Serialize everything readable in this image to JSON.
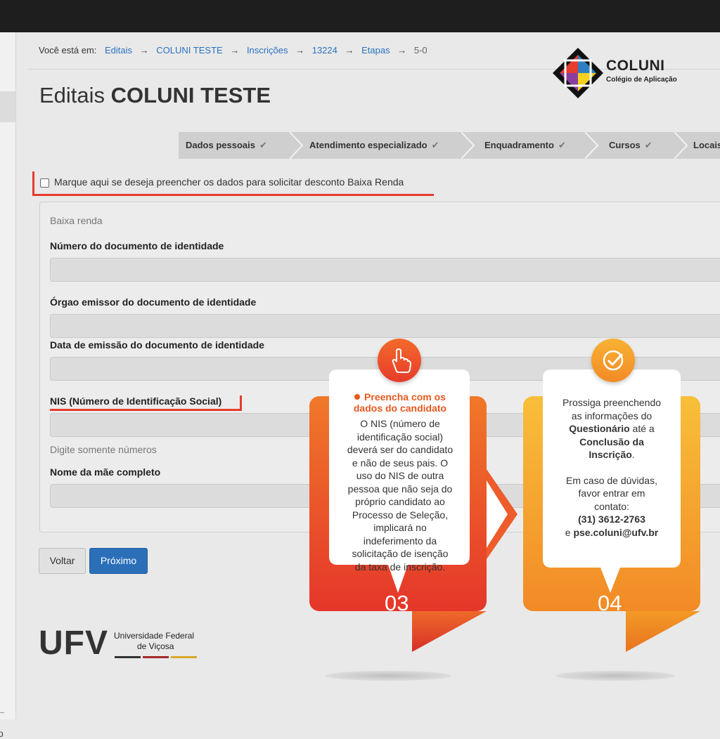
{
  "breadcrumb": {
    "label": "Você está em:",
    "links": [
      "Editais",
      "COLUNI TESTE",
      "Inscrições",
      "13224",
      "Etapas"
    ],
    "current": "5-0",
    "arrow": "→"
  },
  "logo": {
    "name": "COLUNI",
    "subtitle": "Colégio de Aplicação"
  },
  "page": {
    "title_prefix": "Editais",
    "title_bold": "COLUNI TESTE"
  },
  "steps": {
    "items": [
      "Dados pessoais",
      "Atendimento especializado",
      "Enquadramento",
      "Cursos",
      "Locais"
    ],
    "check": "✔"
  },
  "low_income": {
    "checkbox_label": "Marque aqui se deseja preencher os dados para solicitar desconto Baixa Renda",
    "checked": false
  },
  "form": {
    "legend": "Baixa renda",
    "id_number_label": "Número do documento de identidade",
    "issuer_label": "Órgao emissor do documento de identidade",
    "issue_date_label": "Data de emissão do documento de identidade",
    "nis_label": "NIS (Número de Identificação Social)",
    "nis_help": "Digite somente números",
    "mother_name_label": "Nome da mãe completo"
  },
  "buttons": {
    "back": "Voltar",
    "next": "Próximo"
  },
  "ufv": {
    "acronym": "UFV",
    "line1": "Universidade Federal",
    "line2": "de Viçosa"
  },
  "cards": {
    "c03": {
      "number": "03",
      "title_line1": "Preencha com os",
      "title_line2": "dados do candidato",
      "body": [
        "O NIS (número de",
        "identificação social)",
        "deverá ser do candidato",
        "e não de seus pais. O",
        "uso do NIS de outra",
        "pessoa que não seja do",
        "próprio candidato ao",
        "Processo de Seleção,",
        "implicará no",
        "indeferimento da",
        "solicitação de isenção",
        "da taxa de inscrição."
      ]
    },
    "c04": {
      "number": "04",
      "l1": "Prossiga preenchendo",
      "l2": "as informações do",
      "q_bold": "Questionário",
      "q_rest": " até a",
      "l4": "Conclusão da",
      "l5": "Inscrição",
      "l5_rest": ".",
      "l6": "Em caso de dúvidas,",
      "l7": "favor entrar em",
      "l8": "contato:",
      "phone": "(31) 3612-2763",
      "email_prefix": "e ",
      "email": "pse.coluni@ufv.br"
    }
  },
  "colors": {
    "link": "#2a72c0",
    "primary_button": "#2b6fb8",
    "highlight": "#e63b2e",
    "orange_dark": "#e8401f",
    "orange": "#f39a27",
    "yellow": "#f7b733"
  }
}
